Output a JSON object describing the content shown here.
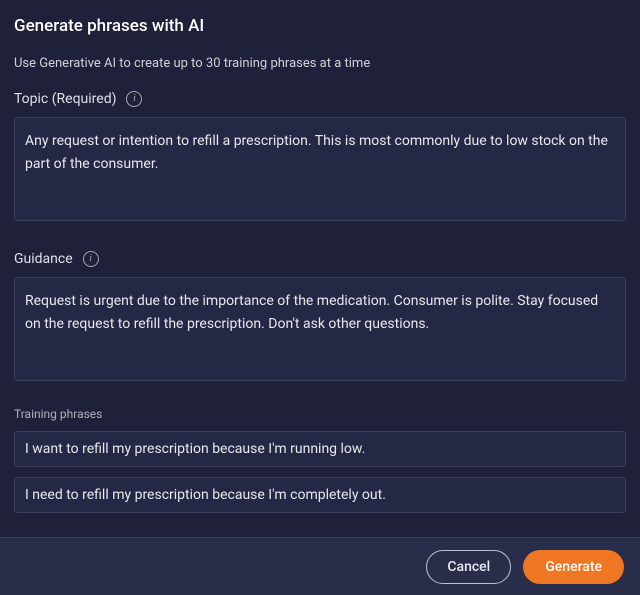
{
  "dialog": {
    "title": "Generate phrases with AI",
    "subtitle": "Use Generative AI to create up to 30 training phrases at a time"
  },
  "topic": {
    "label": "Topic (Required)",
    "value": "Any request or intention to refill a prescription. This is most commonly due to low stock on the part of the consumer."
  },
  "guidance": {
    "label": "Guidance",
    "value": "Request is urgent due to the importance of the medication. Consumer is polite. Stay focused on the request to refill the prescription. Don't ask other questions."
  },
  "training": {
    "label": "Training phrases",
    "phrases": [
      "I want to refill my prescription because I'm running low.",
      "I need to refill my prescription because I'm completely out."
    ]
  },
  "footer": {
    "cancel": "Cancel",
    "generate": "Generate"
  }
}
